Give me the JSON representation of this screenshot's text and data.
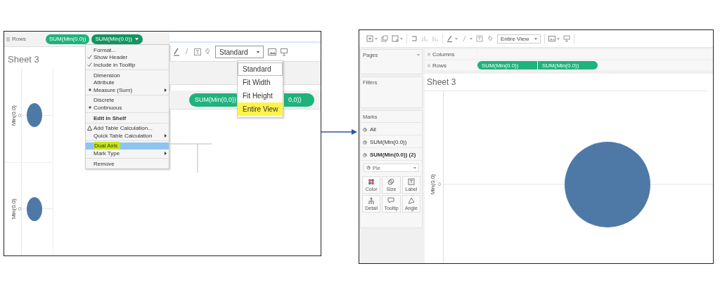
{
  "left_screenshot": {
    "rows_shelf": {
      "label": "Rows",
      "pills": [
        {
          "label": "SUM(Min(0.0))",
          "has_menu": false
        },
        {
          "label": "SUM(Min(0.0))",
          "has_menu": true
        }
      ]
    },
    "sheet_title": "Sheet 3",
    "panes": [
      {
        "axis_label": "Min(0.0)",
        "tick": "0"
      },
      {
        "axis_label": "Min(0.0)",
        "tick": "0"
      }
    ],
    "context_menu": {
      "groups": [
        [
          {
            "label": "Format...",
            "kind": "command",
            "selected": false
          },
          {
            "label": "Show Header",
            "kind": "check",
            "checked": true,
            "selected": false
          },
          {
            "label": "Include in Tooltip",
            "kind": "check",
            "checked": true,
            "selected": false
          }
        ],
        [
          {
            "label": "Dimension",
            "kind": "radio",
            "checked": false,
            "selected": false
          },
          {
            "label": "Attribute",
            "kind": "radio",
            "checked": false,
            "selected": false
          },
          {
            "label": "Measure (Sum)",
            "kind": "radio",
            "checked": true,
            "selected": false,
            "submenu": true
          }
        ],
        [
          {
            "label": "Discrete",
            "kind": "radio",
            "checked": false,
            "selected": false
          },
          {
            "label": "Continuous",
            "kind": "radio",
            "checked": true,
            "selected": false
          }
        ],
        [
          {
            "label": "Edit in Shelf",
            "kind": "emphasis",
            "selected": false
          }
        ],
        [
          {
            "label": "Add Table Calculation...",
            "kind": "calculation",
            "selected": false
          },
          {
            "label": "Quick Table Calculation",
            "kind": "command",
            "selected": false,
            "submenu": true
          }
        ],
        [
          {
            "label": "Dual Axis",
            "kind": "command",
            "selected": true
          },
          {
            "label": "Mark Type",
            "kind": "command",
            "selected": false,
            "submenu": true
          }
        ],
        [
          {
            "label": "Remove",
            "kind": "command",
            "selected": false
          }
        ]
      ]
    },
    "fit_dropdown": {
      "value": "Standard",
      "options": [
        {
          "label": "Standard",
          "selected": true,
          "highlighted": false
        },
        {
          "label": "Fit Width",
          "selected": false,
          "highlighted": false
        },
        {
          "label": "Fit Height",
          "selected": false,
          "highlighted": false
        },
        {
          "label": "Entire View",
          "selected": false,
          "highlighted": true
        }
      ]
    },
    "shelf_pills": [
      "SUM(Min(0,0))",
      "0,0))"
    ]
  },
  "right_screenshot": {
    "fit_dropdown": {
      "value": "Entire View"
    },
    "sidebar": {
      "pages": {
        "title": "Pages"
      },
      "filters": {
        "title": "Filters"
      },
      "marks": {
        "title": "Marks",
        "layers": [
          {
            "label": "All",
            "selected": false
          },
          {
            "label": "SUM(Min(0.0))",
            "selected": false
          },
          {
            "label": "SUM(Min(0.0)) (2)",
            "selected": true
          }
        ],
        "mark_type": "Pie",
        "buttons": [
          {
            "label": "Color",
            "kind": "color"
          },
          {
            "label": "Size",
            "kind": "size"
          },
          {
            "label": "Label",
            "kind": "label"
          },
          {
            "label": "Detail",
            "kind": "detail"
          },
          {
            "label": "Tooltip",
            "kind": "tooltip"
          },
          {
            "label": "Angle",
            "kind": "angle"
          }
        ]
      }
    },
    "columns_shelf": {
      "label": "Columns"
    },
    "rows_shelf": {
      "label": "Rows",
      "pills": [
        "SUM(Min(0.0))",
        "SUM(Min(0.0))"
      ]
    },
    "sheet_title": "Sheet 3",
    "axis_label": "Min(0.0)",
    "tick": "0"
  }
}
